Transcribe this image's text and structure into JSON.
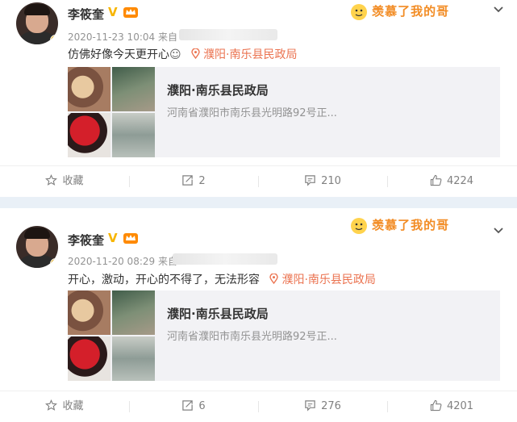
{
  "posts": [
    {
      "user": "李筱奎",
      "verified": "V",
      "time": "2020-11-23 10:04",
      "source_prefix": "来自",
      "text": "仿佛好像今天更开心",
      "emoji": "☺",
      "location": "濮阳·南乐县民政局",
      "card_title": "濮阳·南乐县民政局",
      "card_address": "河南省濮阳市南乐县光明路92号正...",
      "sticker": "羡慕了我的哥",
      "actions": {
        "fav": "收藏",
        "repost": "2",
        "comment": "210",
        "like": "4224"
      }
    },
    {
      "user": "李筱奎",
      "verified": "V",
      "time": "2020-11-20 08:29",
      "source_prefix": "来自",
      "text": "开心，激动，开心的不得了，无法形容",
      "emoji": "",
      "location": "濮阳·南乐县民政局",
      "card_title": "濮阳·南乐县民政局",
      "card_address": "河南省濮阳市南乐县光明路92号正...",
      "sticker": "羡慕了我的哥",
      "actions": {
        "fav": "收藏",
        "repost": "6",
        "comment": "276",
        "like": "4201"
      }
    }
  ],
  "colors": {
    "accent": "#eb7350",
    "gold": "#f7b500",
    "muted": "#939393"
  }
}
